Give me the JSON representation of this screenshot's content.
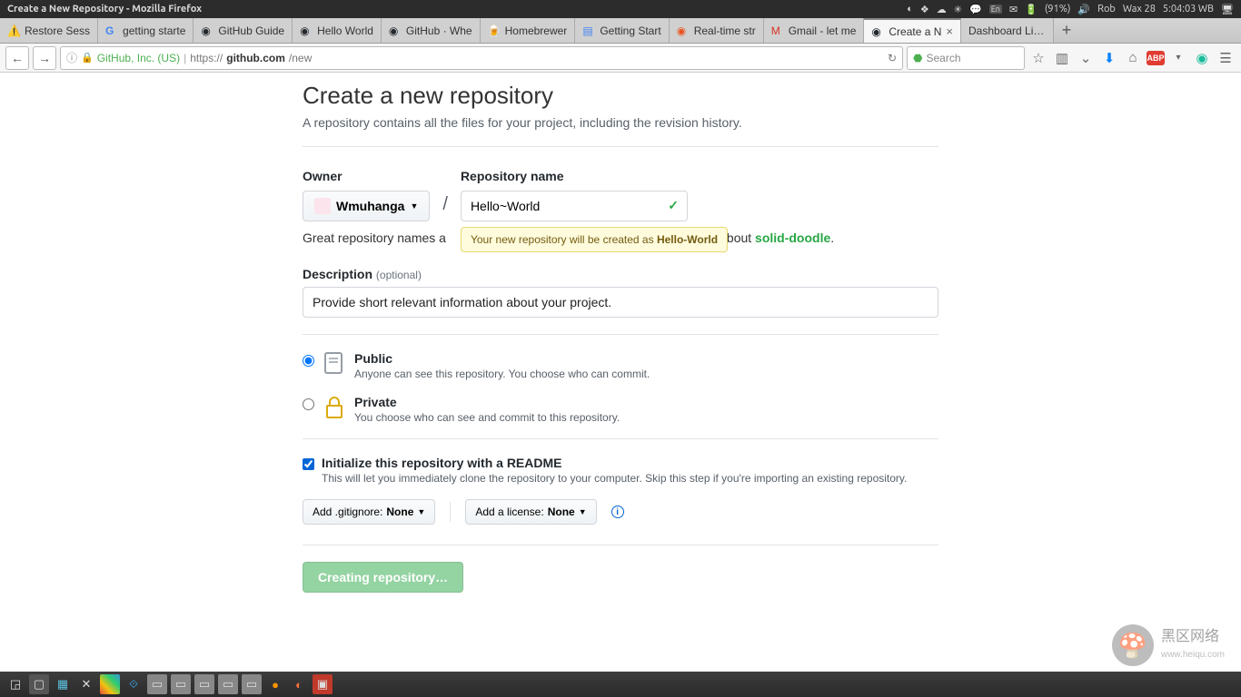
{
  "os": {
    "window_title": "Create a New Repository - Mozilla Firefox",
    "battery": "(91%)",
    "user": "Rob",
    "date": "Wax 28",
    "time": "5:04:03 WB"
  },
  "tabs": [
    {
      "label": "Restore Sess"
    },
    {
      "label": "getting starte"
    },
    {
      "label": "GitHub Guide"
    },
    {
      "label": "Hello World"
    },
    {
      "label": "GitHub · Whe"
    },
    {
      "label": "Homebrewer"
    },
    {
      "label": "Getting Start"
    },
    {
      "label": "Real-time str"
    },
    {
      "label": "Gmail - let me"
    },
    {
      "label": "Create a N",
      "active": true
    },
    {
      "label": "Dashboard Linux"
    }
  ],
  "url": {
    "org": "GitHub, Inc. (US)",
    "prefix": "https://",
    "host": "github.com",
    "path": "/new"
  },
  "search_placeholder": "Search",
  "page": {
    "heading": "Create a new repository",
    "subtitle": "A repository contains all the files for your project, including the revision history.",
    "owner_label": "Owner",
    "owner_value": "Wmuhanga",
    "repo_label": "Repository name",
    "repo_value": "Hello~World",
    "name_tip_prefix": "Your new repository will be created as ",
    "name_tip_bold": "Hello-World",
    "hint_prefix": "Great repository names a",
    "hint_mid": "bout ",
    "hint_link": "solid-doodle",
    "desc_label": "Description",
    "desc_optional": "(optional)",
    "desc_value": "Provide short relevant information about your project.",
    "public_title": "Public",
    "public_sub": "Anyone can see this repository. You choose who can commit.",
    "private_title": "Private",
    "private_sub": "You choose who can see and commit to this repository.",
    "readme_title": "Initialize this repository with a README",
    "readme_sub": "This will let you immediately clone the repository to your computer. Skip this step if you're importing an existing repository.",
    "gitignore_prefix": "Add .gitignore: ",
    "gitignore_value": "None",
    "license_prefix": "Add a license: ",
    "license_value": "None",
    "submit": "Creating repository…"
  },
  "watermark": {
    "line1": "黑区网络",
    "line2": "www.heiqu.com"
  }
}
